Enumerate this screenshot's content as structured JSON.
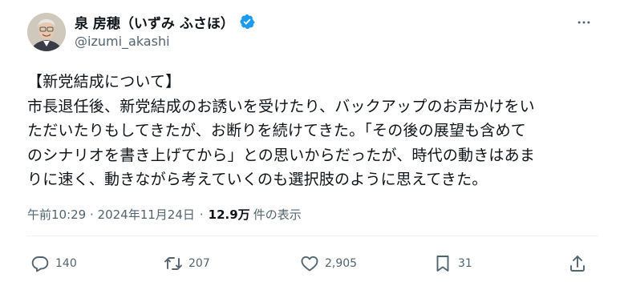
{
  "tweet": {
    "display_name": "泉 房穂（いずみ ふさほ）",
    "handle": "@izumi_akashi",
    "verified": true,
    "body_lines": [
      "【新党結成について】",
      "市長退任後、新党結成のお誘いを受けたり、バックアップのお声かけをい",
      "ただいたりもしてきたが、お断りを続けてきた。「その後の展望も含めて",
      "のシナリオを書き上げてから」との思いからだったが、時代の動きはあま",
      "りに速く、動きながら考えていくのも選択肢のように思えてきた。"
    ],
    "timestamp": "午前10:29 · 2024年11月24日",
    "views_count": "12.9万",
    "views_label": "件の表示",
    "meta_separator": "·",
    "replies": "140",
    "retweets": "207",
    "likes": "2,905",
    "bookmarks": "31"
  },
  "icons": {
    "more": "more-horizontal-icon",
    "reply": "reply-icon",
    "retweet": "retweet-icon",
    "like": "heart-icon",
    "bookmark": "bookmark-icon",
    "share": "share-icon",
    "verified": "verified-badge-icon"
  },
  "colors": {
    "text": "#0f1419",
    "secondary": "#536471",
    "verified": "#1d9bf0",
    "divider": "#eff3f4"
  }
}
